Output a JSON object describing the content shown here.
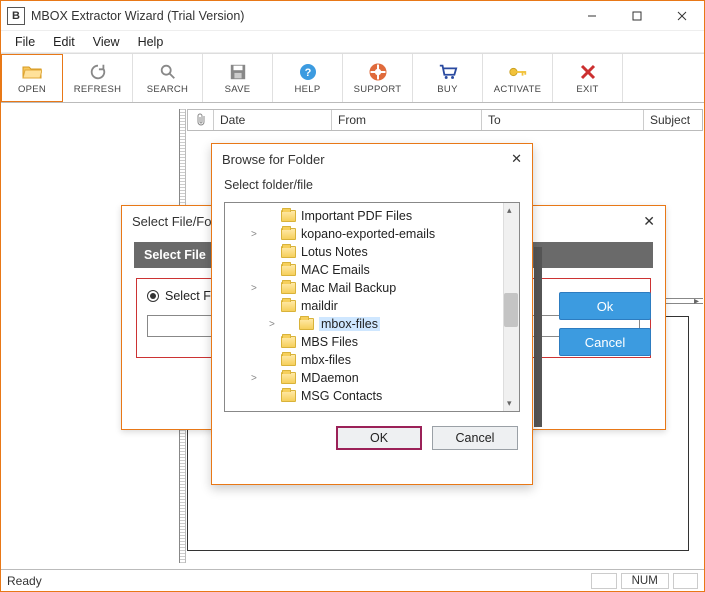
{
  "titlebar": {
    "title": "MBOX Extractor Wizard (Trial Version)"
  },
  "menu": {
    "file": "File",
    "edit": "Edit",
    "view": "View",
    "help": "Help"
  },
  "toolbar": {
    "open": "OPEN",
    "refresh": "REFRESH",
    "search": "SEARCH",
    "save": "SAVE",
    "help": "HELP",
    "support": "SUPPORT",
    "buy": "BUY",
    "activate": "ACTIVATE",
    "exit": "EXIT"
  },
  "columns": {
    "date": "Date",
    "from": "From",
    "to": "To",
    "subject": "Subject"
  },
  "status": {
    "ready": "Ready",
    "num": "NUM"
  },
  "dlg1": {
    "title": "Select File/Folder",
    "bar": "Select File",
    "radio": "Select Folder",
    "ok": "Ok",
    "cancel": "Cancel"
  },
  "dlg2": {
    "title": "Browse for Folder",
    "subtitle": "Select folder/file",
    "ok": "OK",
    "cancel": "Cancel",
    "items": [
      {
        "label": "Important PDF Files",
        "expander": "",
        "depth": 0
      },
      {
        "label": "kopano-exported-emails",
        "expander": ">",
        "depth": 0
      },
      {
        "label": "Lotus Notes",
        "expander": "",
        "depth": 0
      },
      {
        "label": "MAC Emails",
        "expander": "",
        "depth": 0
      },
      {
        "label": "Mac Mail Backup",
        "expander": ">",
        "depth": 0
      },
      {
        "label": "maildir",
        "expander": "",
        "depth": 0
      },
      {
        "label": "mbox-files",
        "expander": ">",
        "depth": 1,
        "selected": true
      },
      {
        "label": "MBS Files",
        "expander": "",
        "depth": 0
      },
      {
        "label": "mbx-files",
        "expander": "",
        "depth": 0
      },
      {
        "label": "MDaemon",
        "expander": ">",
        "depth": 0
      },
      {
        "label": "MSG Contacts",
        "expander": "",
        "depth": 0
      }
    ]
  }
}
